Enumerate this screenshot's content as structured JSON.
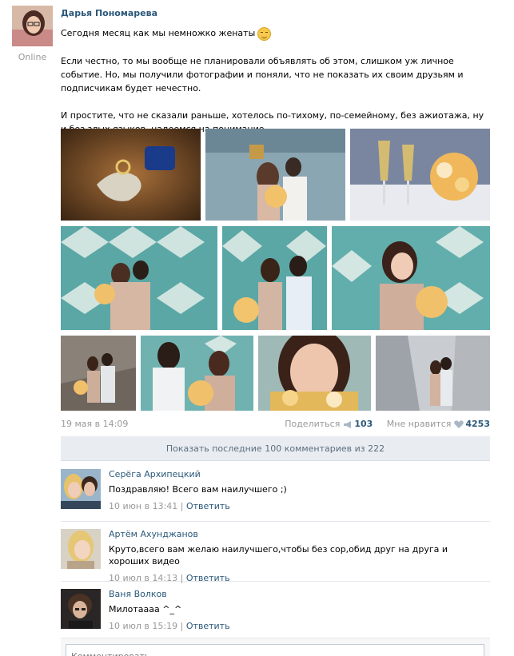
{
  "post": {
    "author": "Дарья Пономарева",
    "status": "Online",
    "text_line1": "Сегодня месяц как мы немножко женаты",
    "paragraph2": "Если честно, то мы вообще не планировали объявлять об этом, слишком уж личное событие. Но, мы получили фотографии и поняли, что не показать их своим друзьям и подписчикам будет нечестно.",
    "paragraph3": "И простите, что не сказали раньше, хотелось по-тихому, по-семейному, без ажиотажа, ну и без злых языков, надеемся на понимание.",
    "date": "19 мая в 14:09",
    "share_label": "Поделиться",
    "share_count": "103",
    "like_label": "Мне нравится",
    "like_count": "4253"
  },
  "show_comments": "Показать последние 100 комментариев из 222",
  "comments": [
    {
      "author": "Серёга Архипецкий",
      "text": "Поздравляю! Всего вам наилучшего ;)",
      "date": "10 июн в 13:41",
      "reply": "Ответить"
    },
    {
      "author": "Артём Ахунджанов",
      "text": "Круто,всего вам желаю наилучшего,чтобы без сор,обид друг на друга и хороших видео",
      "date": "10 июл в 14:13",
      "reply": "Ответить"
    },
    {
      "author": "Ваня Волков",
      "text": "Милотаааа ^_^",
      "date": "10 июл в 15:19",
      "reply": "Ответить"
    }
  ],
  "comment_input": {
    "placeholder": "Комментировать..."
  },
  "colors": {
    "link": "#2b587a",
    "muted": "#999999",
    "bar": "#e9edf1"
  }
}
